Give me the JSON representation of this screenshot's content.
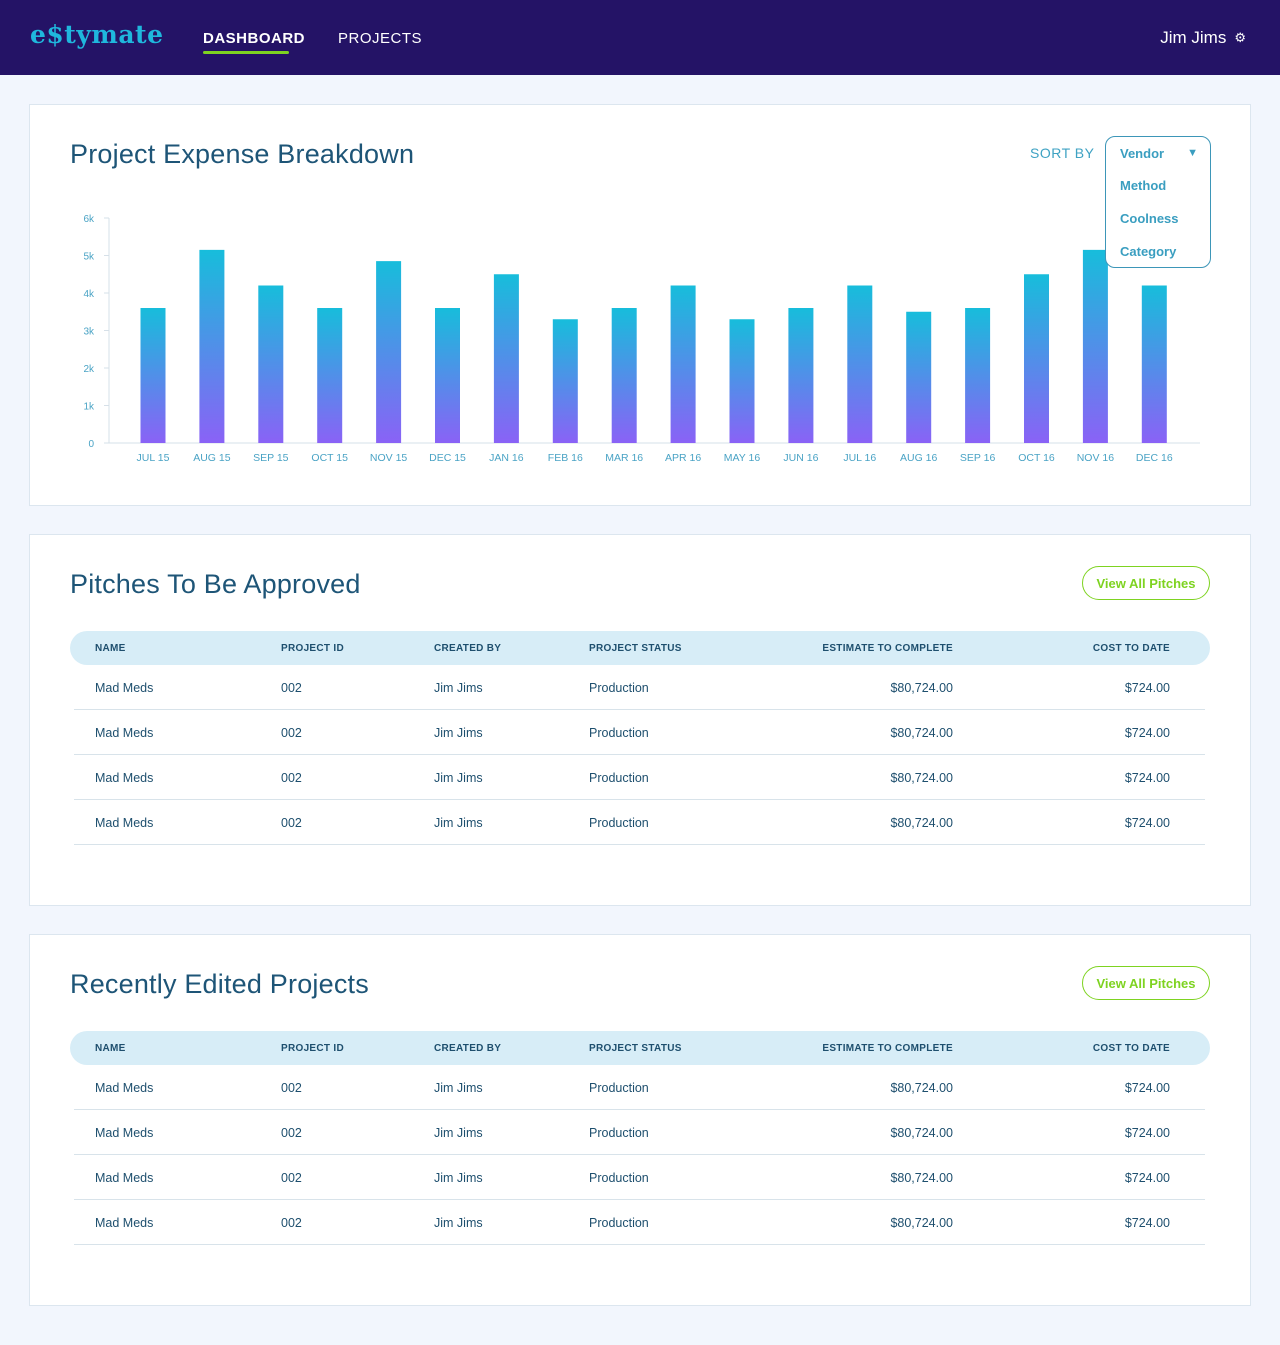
{
  "app": {
    "logo": "e$tymate",
    "nav": [
      {
        "label": "DASHBOARD",
        "active": true
      },
      {
        "label": "PROJECTS",
        "active": false
      }
    ],
    "user": {
      "name": "Jim Jims",
      "icon": "gear-icon"
    }
  },
  "expense_card": {
    "title": "Project Expense Breakdown",
    "sort_label": "SORT BY",
    "sort_options": [
      "Vendor",
      "Method",
      "Coolness",
      "Category"
    ],
    "sort_selected": "Vendor"
  },
  "chart_data": {
    "type": "bar",
    "title": "Project Expense Breakdown",
    "categories": [
      "JUL 15",
      "AUG 15",
      "SEP 15",
      "OCT 15",
      "NOV 15",
      "DEC 15",
      "JAN 16",
      "FEB 16",
      "MAR 16",
      "APR 16",
      "MAY 16",
      "JUN 16",
      "JUL 16",
      "AUG 16",
      "SEP 16",
      "OCT 16",
      "NOV 16",
      "DEC 16"
    ],
    "values": [
      3600,
      5150,
      4200,
      3600,
      4850,
      3600,
      4500,
      3300,
      3600,
      4200,
      3300,
      3600,
      4200,
      3500,
      3600,
      4500,
      5150,
      4200
    ],
    "ylim": [
      0,
      6000
    ],
    "yticks": [
      0,
      1000,
      2000,
      3000,
      4000,
      5000,
      6000
    ],
    "ytick_labels": [
      "0",
      "1k",
      "2k",
      "3k",
      "4k",
      "5k",
      "6k"
    ],
    "xlabel": "",
    "ylabel": "",
    "grid": false,
    "colors": {
      "bar_top": "#17bddb",
      "bar_bottom": "#8a62f6",
      "axis": "#d6e0e8",
      "tick_label": "#4aa3c5"
    }
  },
  "pitches_card": {
    "title": "Pitches To Be Approved",
    "button": "View All Pitches",
    "columns": [
      "NAME",
      "PROJECT ID",
      "CREATED BY",
      "PROJECT STATUS",
      "ESTIMATE TO COMPLETE",
      "COST TO DATE"
    ],
    "rows": [
      [
        "Mad Meds",
        "002",
        "Jim Jims",
        "Production",
        "$80,724.00",
        "$724.00"
      ],
      [
        "Mad Meds",
        "002",
        "Jim Jims",
        "Production",
        "$80,724.00",
        "$724.00"
      ],
      [
        "Mad Meds",
        "002",
        "Jim Jims",
        "Production",
        "$80,724.00",
        "$724.00"
      ],
      [
        "Mad Meds",
        "002",
        "Jim Jims",
        "Production",
        "$80,724.00",
        "$724.00"
      ]
    ]
  },
  "recent_card": {
    "title": "Recently Edited Projects",
    "button": "View All Pitches",
    "columns": [
      "NAME",
      "PROJECT ID",
      "CREATED BY",
      "PROJECT STATUS",
      "ESTIMATE TO COMPLETE",
      "COST TO DATE"
    ],
    "rows": [
      [
        "Mad Meds",
        "002",
        "Jim Jims",
        "Production",
        "$80,724.00",
        "$724.00"
      ],
      [
        "Mad Meds",
        "002",
        "Jim Jims",
        "Production",
        "$80,724.00",
        "$724.00"
      ],
      [
        "Mad Meds",
        "002",
        "Jim Jims",
        "Production",
        "$80,724.00",
        "$724.00"
      ],
      [
        "Mad Meds",
        "002",
        "Jim Jims",
        "Production",
        "$80,724.00",
        "$724.00"
      ]
    ]
  },
  "colors": {
    "nav_bg": "#241366",
    "accent_green": "#7ed321",
    "accent_blue": "#1fb7dd",
    "page_bg": "#f2f6fd"
  }
}
